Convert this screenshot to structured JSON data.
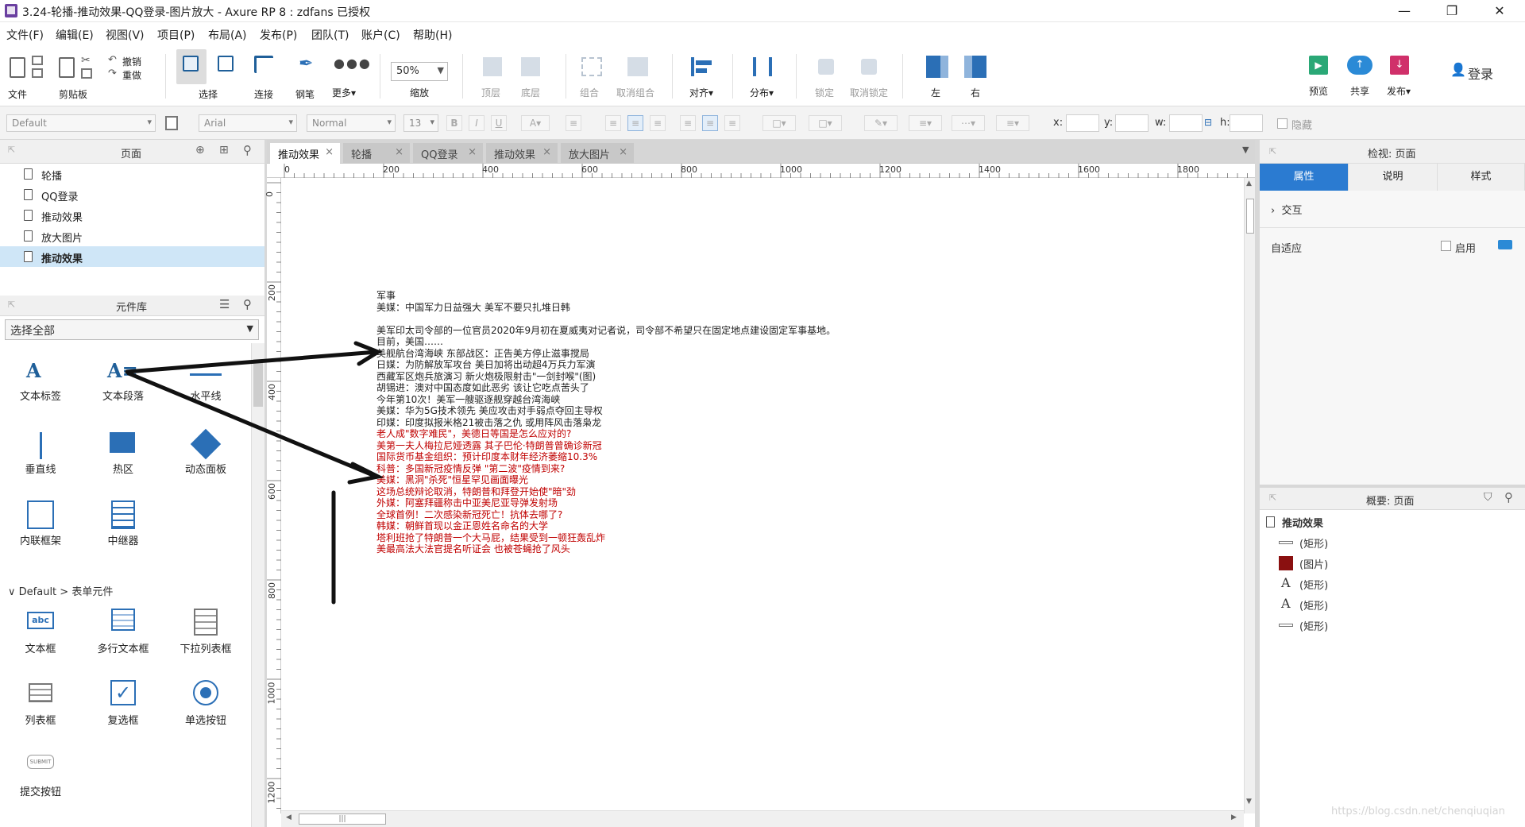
{
  "window": {
    "title": "3.24-轮播-推动效果-QQ登录-图片放大 - Axure RP 8 : zdfans 已授权",
    "minimize_label": "—",
    "restore_label": "❐",
    "close_label": "✕"
  },
  "menu": [
    "文件(F)",
    "编辑(E)",
    "视图(V)",
    "项目(P)",
    "布局(A)",
    "发布(P)",
    "团队(T)",
    "账户(C)",
    "帮助(H)"
  ],
  "toolbar": {
    "file": "文件",
    "clipboard": "剪贴板",
    "undo": "撤销",
    "redo": "重做",
    "select": "选择",
    "connect": "连接",
    "pen": "钢笔",
    "more": "更多▾",
    "zoom_value": "50%",
    "zoom": "缩放",
    "top_layer": "顶层",
    "bottom_layer": "底层",
    "group": "组合",
    "ungroup": "取消组合",
    "align": "对齐▾",
    "distribute": "分布▾",
    "lock": "锁定",
    "unlock": "取消锁定",
    "left": "左",
    "right": "右",
    "preview": "预览",
    "share": "共享",
    "publish": "发布▾",
    "login": "登录"
  },
  "formatbar": {
    "style": "Default",
    "font": "Arial",
    "weight": "Normal",
    "size": "13",
    "x_label": "x:",
    "y_label": "y:",
    "w_label": "w:",
    "h_label": "h:",
    "hidden_label": "隐藏"
  },
  "pages_panel": {
    "title": "页面",
    "pages": [
      {
        "label": "轮播",
        "selected": false
      },
      {
        "label": "QQ登录",
        "selected": false
      },
      {
        "label": "推动效果",
        "selected": false
      },
      {
        "label": "放大图片",
        "selected": false
      },
      {
        "label": "推动效果",
        "selected": true
      }
    ]
  },
  "library_panel": {
    "title": "元件库",
    "selector": "选择全部",
    "widgets_row1": [
      "文本标签",
      "文本段落",
      "水平线"
    ],
    "widgets_row2": [
      "垂直线",
      "热区",
      "动态面板"
    ],
    "widgets_row3": [
      "内联框架",
      "中继器"
    ],
    "section": "Default > 表单元件",
    "form_row1": [
      "文本框",
      "多行文本框",
      "下拉列表框"
    ],
    "form_row2": [
      "列表框",
      "复选框",
      "单选按钮"
    ],
    "form_row3": [
      "提交按钮"
    ],
    "textbox_icon_text": "abc",
    "submit_icon_text": "SUBMIT"
  },
  "tabs": [
    "推动效果",
    "轮播",
    "QQ登录",
    "推动效果",
    "放大图片"
  ],
  "ruler": {
    "h": [
      "0",
      "200",
      "400",
      "600",
      "800",
      "1000",
      "1200",
      "1400",
      "1600",
      "1800"
    ],
    "v": [
      "0",
      "200",
      "400",
      "600",
      "800",
      "1000",
      "1200"
    ]
  },
  "canvas_text": {
    "black": [
      "军事",
      "美媒：中国军力日益强大 美军不要只扎堆日韩",
      "",
      "美军印太司令部的一位官员2020年9月初在夏威夷对记者说，司令部不希望只在固定地点建设固定军事基地。",
      "目前，美国……",
      "美舰航台湾海峡 东部战区：正告美方停止滋事搅局",
      "日媒：为防解放军攻台 美日加将出动超4万兵力军演",
      "西藏军区炮兵旅演习 新火炮极限射击\"一剑封喉\"(图)",
      "胡锡进：澳对中国态度如此恶劣 该让它吃点苦头了",
      "今年第10次！美军一艘驱逐舰穿越台湾海峡",
      "美媒：华为5G技术领先 美应攻击对手弱点夺回主导权",
      "印媒：印度拟报米格21被击落之仇 或用阵风击落枭龙"
    ],
    "red": [
      "老人成\"数字难民\"，美德日等国是怎么应对的?",
      "美第一夫人梅拉尼娅透露 其子巴伦·特朗普曾确诊新冠",
      "国际货币基金组织：预计印度本财年经济萎缩10.3%",
      "科普：多国新冠疫情反弹 \"第二波\"疫情到来?",
      "美媒：黑洞\"杀死\"恒星罕见画面曝光",
      "这场总统辩论取消，特朗普和拜登开始使\"暗\"劲",
      "外媒：阿塞拜疆称击中亚美尼亚导弹发射场",
      "全球首例！二次感染新冠死亡！抗体去哪了?",
      "韩媒：朝鲜首现以金正恩姓名命名的大学",
      "塔利班抢了特朗普一个大马屁，结果受到一顿狂轰乱炸",
      "美最高法大法官提名听证会 也被苍蝇抢了风头"
    ]
  },
  "inspector": {
    "title": "检视: 页面",
    "tabs": [
      "属性",
      "说明",
      "样式"
    ],
    "interaction": "交互",
    "adaptive": "自适应",
    "enable": "启用"
  },
  "outline": {
    "title": "概要: 页面",
    "root": "推动效果",
    "items": [
      "(矩形)",
      "(图片)",
      "(矩形)",
      "(矩形)",
      "(矩形)"
    ]
  },
  "watermark": "https://blog.csdn.net/chenqiuqian"
}
